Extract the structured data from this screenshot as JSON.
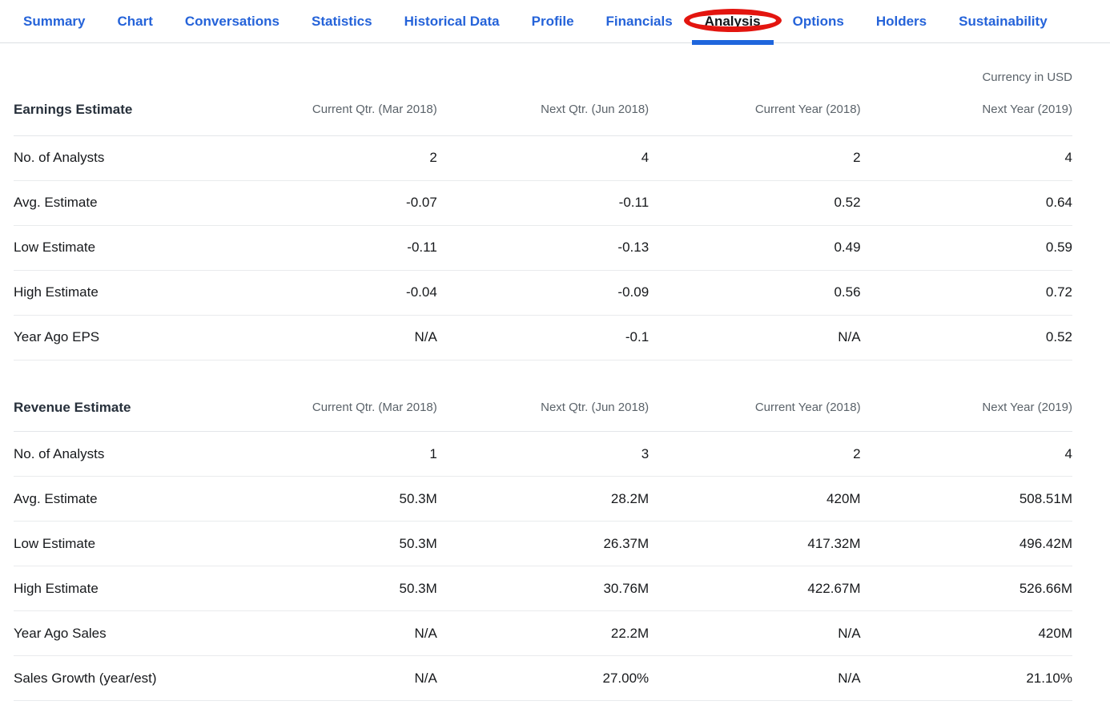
{
  "nav": {
    "tabs": [
      "Summary",
      "Chart",
      "Conversations",
      "Statistics",
      "Historical Data",
      "Profile",
      "Financials",
      "Analysis",
      "Options",
      "Holders",
      "Sustainability"
    ],
    "active_tab": "Analysis",
    "annotation": "red-ellipse-around-analysis"
  },
  "currency_note": "Currency in USD",
  "colors": {
    "tab_blue": "#2563d9",
    "active_underline_blue": "#1f66dd",
    "annotation_red": "#e3150f",
    "header_gray_text": "#5b636a",
    "body_dark_text": "#17191c"
  },
  "tables": [
    {
      "title": "Earnings Estimate",
      "columns": [
        "Current Qtr. (Mar 2018)",
        "Next Qtr. (Jun 2018)",
        "Current Year (2018)",
        "Next Year (2019)"
      ],
      "rows": [
        {
          "label": "No. of Analysts",
          "values": [
            "2",
            "4",
            "2",
            "4"
          ]
        },
        {
          "label": "Avg. Estimate",
          "values": [
            "-0.07",
            "-0.11",
            "0.52",
            "0.64"
          ]
        },
        {
          "label": "Low Estimate",
          "values": [
            "-0.11",
            "-0.13",
            "0.49",
            "0.59"
          ]
        },
        {
          "label": "High Estimate",
          "values": [
            "-0.04",
            "-0.09",
            "0.56",
            "0.72"
          ]
        },
        {
          "label": "Year Ago EPS",
          "values": [
            "N/A",
            "-0.1",
            "N/A",
            "0.52"
          ]
        }
      ]
    },
    {
      "title": "Revenue Estimate",
      "columns": [
        "Current Qtr. (Mar 2018)",
        "Next Qtr. (Jun 2018)",
        "Current Year (2018)",
        "Next Year (2019)"
      ],
      "rows": [
        {
          "label": "No. of Analysts",
          "values": [
            "1",
            "3",
            "2",
            "4"
          ]
        },
        {
          "label": "Avg. Estimate",
          "values": [
            "50.3M",
            "28.2M",
            "420M",
            "508.51M"
          ]
        },
        {
          "label": "Low Estimate",
          "values": [
            "50.3M",
            "26.37M",
            "417.32M",
            "496.42M"
          ]
        },
        {
          "label": "High Estimate",
          "values": [
            "50.3M",
            "30.76M",
            "422.67M",
            "526.66M"
          ]
        },
        {
          "label": "Year Ago Sales",
          "values": [
            "N/A",
            "22.2M",
            "N/A",
            "420M"
          ]
        },
        {
          "label": "Sales Growth (year/est)",
          "values": [
            "N/A",
            "27.00%",
            "N/A",
            "21.10%"
          ]
        }
      ]
    }
  ]
}
